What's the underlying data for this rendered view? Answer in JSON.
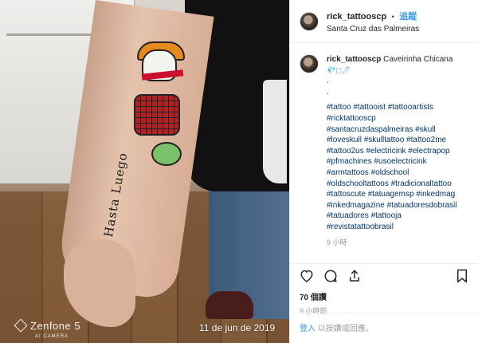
{
  "post": {
    "username": "rick_tattooscp",
    "follow_label": "追蹤",
    "location": "Santa Cruz das Palmeiras",
    "photo_watermark_brand": "Zenfone 5",
    "photo_watermark_sub": "AI CAMERA",
    "photo_date": "11 de jun de 2019",
    "tattoo_text": "Hasta Luego"
  },
  "caption": {
    "username": "rick_tattooscp",
    "title": "Caveirinha Chicana",
    "emoji_line": "💎◻🖋",
    "dot_line_1": ".",
    "dot_line_2": ".",
    "hashtags_lines": [
      "#tattoo #tattooist #tattooartists",
      "#ricktattooscp",
      "#santacruzdaspalmeiras #skull",
      "#loveskull #skulltattoo #tattoo2me",
      "#tattoo2us #electricink #electrapop",
      "#pfmachines #usoelectricink",
      "#armtattoos #oldschool",
      "#oldschooltattoos #tradicionaltattoo",
      "#tattoscute #tatuagemsp #inkedmag",
      "#inkedmagazine #tatuadoresdobrasil",
      "#tatuadores #tattooja",
      "#revistatattoobrasil"
    ],
    "time": "9 小時"
  },
  "actions": {
    "likes": "70 個讚",
    "posted_time": "9 小時前"
  },
  "login": {
    "link": "登入",
    "rest": "以按讚或回應。"
  },
  "icons": {
    "like": "heart-icon",
    "comment": "comment-icon",
    "share": "share-icon",
    "save": "bookmark-icon"
  }
}
